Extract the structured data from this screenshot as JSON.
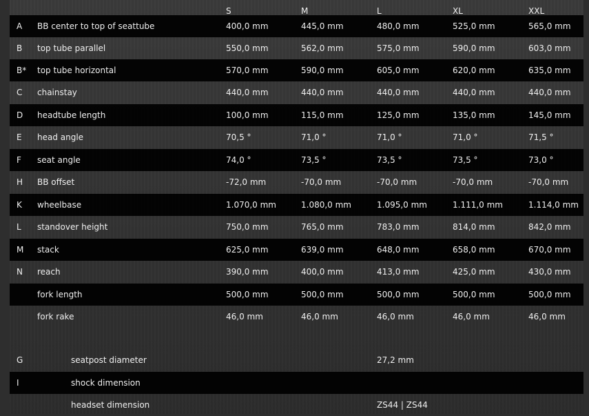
{
  "header": {
    "sizes": [
      "S",
      "M",
      "L",
      "XL",
      "XXL"
    ]
  },
  "rows": [
    {
      "letter": "A",
      "label": "BB center to top of seattube",
      "values": [
        "400,0 mm",
        "445,0 mm",
        "480,0 mm",
        "525,0 mm",
        "565,0 mm"
      ]
    },
    {
      "letter": "B",
      "label": "top tube parallel",
      "values": [
        "550,0 mm",
        "562,0 mm",
        "575,0 mm",
        "590,0 mm",
        "603,0 mm"
      ]
    },
    {
      "letter": "B*",
      "label": "top tube horizontal",
      "values": [
        "570,0 mm",
        "590,0 mm",
        "605,0 mm",
        "620,0 mm",
        "635,0 mm"
      ]
    },
    {
      "letter": "C",
      "label": "chainstay",
      "values": [
        "440,0 mm",
        "440,0 mm",
        "440,0 mm",
        "440,0 mm",
        "440,0 mm"
      ]
    },
    {
      "letter": "D",
      "label": "headtube length",
      "values": [
        "100,0 mm",
        "115,0 mm",
        "125,0 mm",
        "135,0 mm",
        "145,0 mm"
      ]
    },
    {
      "letter": "E",
      "label": "head angle",
      "values": [
        "70,5 °",
        "71,0 °",
        "71,0 °",
        "71,0 °",
        "71,5 °"
      ]
    },
    {
      "letter": "F",
      "label": "seat angle",
      "values": [
        "74,0 °",
        "73,5 °",
        "73,5 °",
        "73,5 °",
        "73,0 °"
      ]
    },
    {
      "letter": "H",
      "label": "BB offset",
      "values": [
        "-72,0 mm",
        "-70,0 mm",
        "-70,0 mm",
        "-70,0 mm",
        "-70,0 mm"
      ]
    },
    {
      "letter": "K",
      "label": "wheelbase",
      "values": [
        "1.070,0 mm",
        "1.080,0 mm",
        "1.095,0 mm",
        "1.111,0 mm",
        "1.114,0 mm"
      ]
    },
    {
      "letter": "L",
      "label": "standover height",
      "values": [
        "750,0 mm",
        "765,0 mm",
        "783,0 mm",
        "814,0 mm",
        "842,0 mm"
      ]
    },
    {
      "letter": "M",
      "label": "stack",
      "values": [
        "625,0 mm",
        "639,0 mm",
        "648,0 mm",
        "658,0 mm",
        "670,0 mm"
      ]
    },
    {
      "letter": "N",
      "label": "reach",
      "values": [
        "390,0 mm",
        "400,0 mm",
        "413,0 mm",
        "425,0 mm",
        "430,0 mm"
      ]
    },
    {
      "letter": "",
      "label": "fork length",
      "values": [
        "500,0 mm",
        "500,0 mm",
        "500,0 mm",
        "500,0 mm",
        "500,0 mm"
      ]
    },
    {
      "letter": "",
      "label": "fork rake",
      "values": [
        "46,0 mm",
        "46,0 mm",
        "46,0 mm",
        "46,0 mm",
        "46,0 mm"
      ]
    }
  ],
  "extra_rows": [
    {
      "letter": "G",
      "label": "seatpost diameter",
      "value": "27,2 mm"
    },
    {
      "letter": "I",
      "label": "shock dimension",
      "value": ""
    },
    {
      "letter": "",
      "label": "headset dimension",
      "value": "ZS44 | ZS44"
    }
  ]
}
